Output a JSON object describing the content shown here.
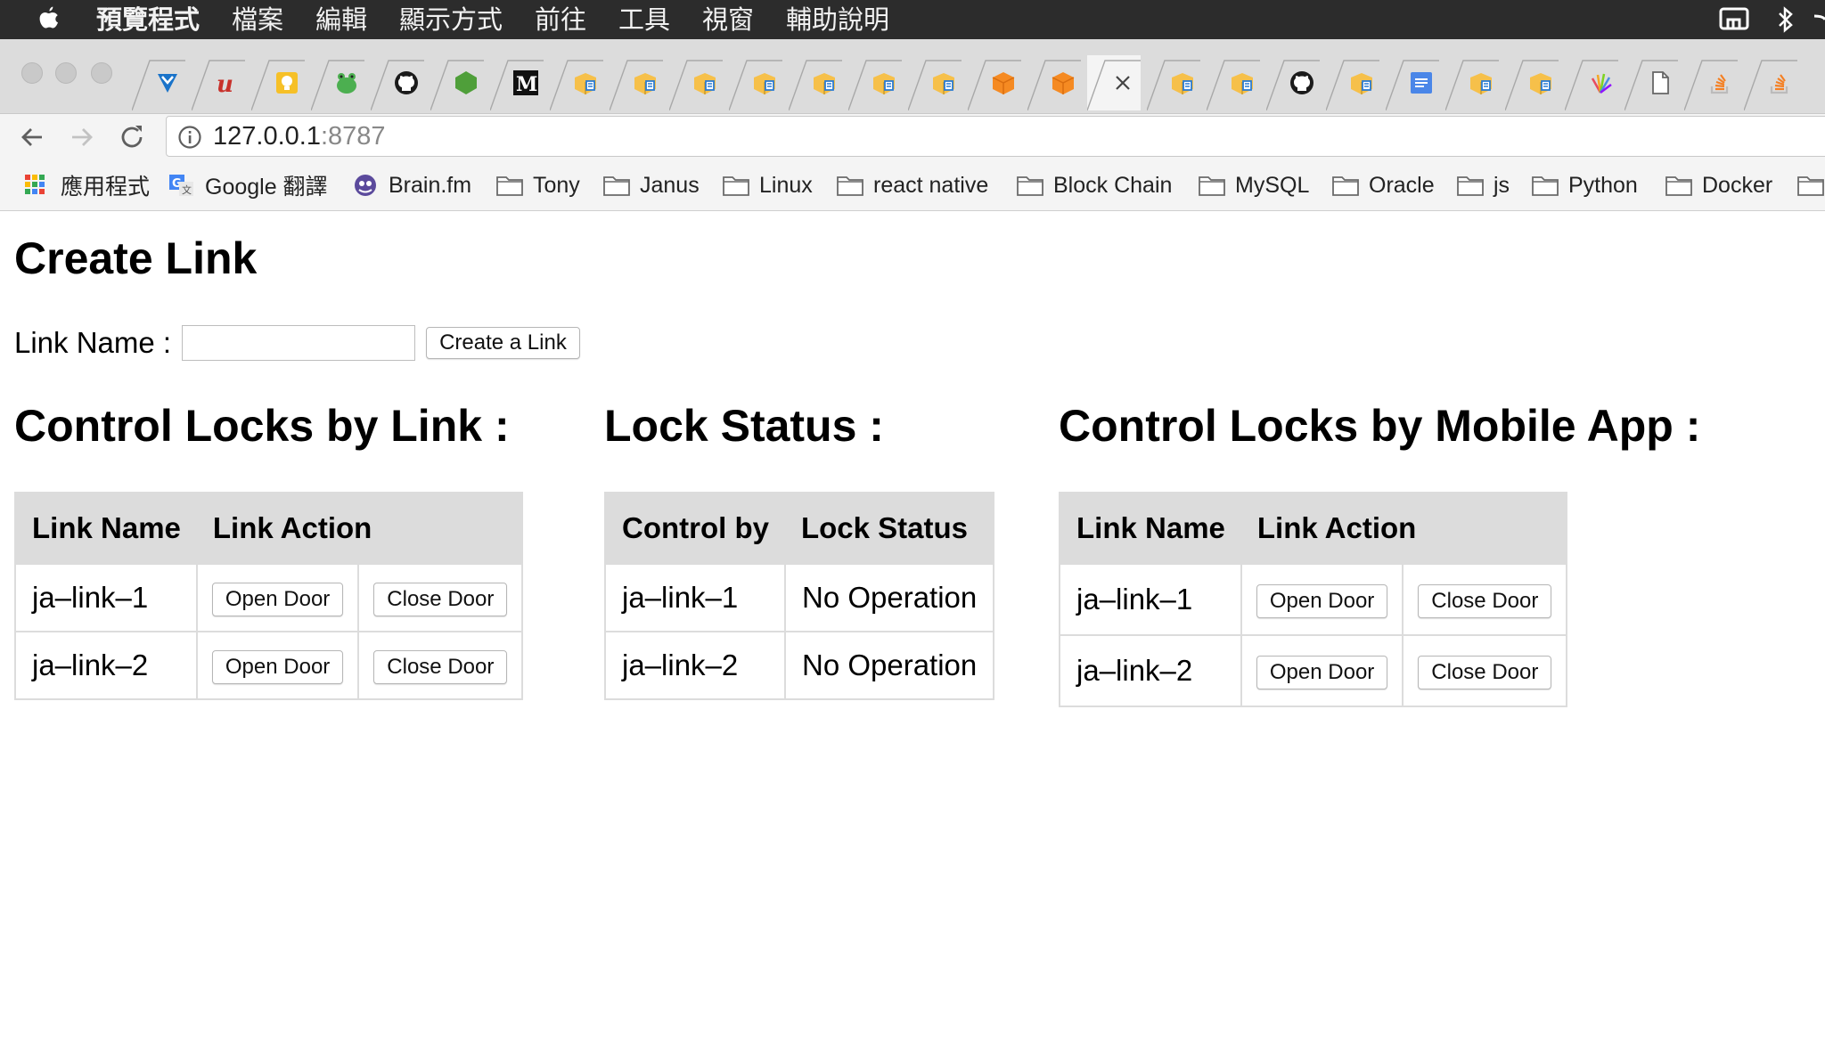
{
  "menubar": {
    "app_name": "預覽程式",
    "items": [
      "檔案",
      "編輯",
      "顯示方式",
      "前往",
      "工具",
      "視窗",
      "輔助說明"
    ]
  },
  "tabs": [
    {
      "icon": "y-shield-icon"
    },
    {
      "icon": "u-icon"
    },
    {
      "icon": "lightbulb-icon"
    },
    {
      "icon": "frog-icon"
    },
    {
      "icon": "github-icon"
    },
    {
      "icon": "hexagon-icon"
    },
    {
      "icon": "medium-icon",
      "glyph": "M"
    },
    {
      "icon": "book-icon"
    },
    {
      "icon": "book-icon"
    },
    {
      "icon": "book-icon"
    },
    {
      "icon": "book-icon"
    },
    {
      "icon": "book-icon"
    },
    {
      "icon": "book-icon"
    },
    {
      "icon": "book-icon"
    },
    {
      "icon": "cube-icon"
    },
    {
      "icon": "cube-icon"
    },
    {
      "icon": "close-icon",
      "glyph": "×",
      "active": true
    },
    {
      "icon": "book-icon"
    },
    {
      "icon": "book-icon"
    },
    {
      "icon": "github-icon"
    },
    {
      "icon": "book-icon"
    },
    {
      "icon": "docs-icon"
    },
    {
      "icon": "book-icon"
    },
    {
      "icon": "book-icon"
    },
    {
      "icon": "sparkle-icon"
    },
    {
      "icon": "page-icon"
    },
    {
      "icon": "stack-icon"
    },
    {
      "icon": "stack-icon"
    }
  ],
  "address_bar": {
    "host": "127.0.0.1",
    "port": ":8787"
  },
  "bookmarks": [
    {
      "label": "應用程式",
      "icon": "apps-grid-icon"
    },
    {
      "label": "Google 翻譯",
      "icon": "google-translate-icon"
    },
    {
      "label": "Brain.fm",
      "icon": "brain-fm-icon"
    },
    {
      "label": "Tony",
      "icon": "folder-icon"
    },
    {
      "label": "Janus",
      "icon": "folder-icon"
    },
    {
      "label": "Linux",
      "icon": "folder-icon"
    },
    {
      "label": "react native",
      "icon": "folder-icon"
    },
    {
      "label": "Block Chain",
      "icon": "folder-icon"
    },
    {
      "label": "MySQL",
      "icon": "folder-icon"
    },
    {
      "label": "Oracle",
      "icon": "folder-icon"
    },
    {
      "label": "js",
      "icon": "folder-icon"
    },
    {
      "label": "Python",
      "icon": "folder-icon"
    },
    {
      "label": "Docker",
      "icon": "folder-icon"
    },
    {
      "label": "",
      "icon": "folder-icon"
    }
  ],
  "page": {
    "title": "Create Link",
    "form": {
      "label": "Link Name :",
      "input_value": "",
      "button": "Create a Link"
    },
    "control_by_link": {
      "heading": "Control Locks by Link :",
      "headers": [
        "Link Name",
        "Link Action"
      ],
      "rows": [
        {
          "name": "ja–link–1",
          "open": "Open Door",
          "close": "Close Door"
        },
        {
          "name": "ja–link–2",
          "open": "Open Door",
          "close": "Close Door"
        }
      ]
    },
    "lock_status": {
      "heading": "Lock Status :",
      "headers": [
        "Control by",
        "Lock Status"
      ],
      "rows": [
        {
          "control": "ja–link–1",
          "status": "No Operation"
        },
        {
          "control": "ja–link–2",
          "status": "No Operation"
        }
      ]
    },
    "control_by_app": {
      "heading": "Control Locks by Mobile App :",
      "headers": [
        "Link Name",
        "Link Action"
      ],
      "rows": [
        {
          "name": "ja–link–1",
          "open": "Open Door",
          "close": "Close Door"
        },
        {
          "name": "ja–link–2",
          "open": "Open Door",
          "close": "Close Door"
        }
      ]
    }
  }
}
